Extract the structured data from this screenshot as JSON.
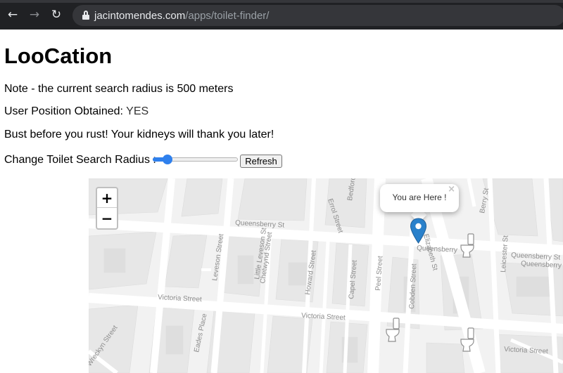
{
  "browser": {
    "url_host": "jacintomendes.com",
    "url_path": "/apps/toilet-finder/",
    "back_icon": "←",
    "forward_icon": "→",
    "reload_icon": "↻"
  },
  "page": {
    "title": "LooCation",
    "note": "Note - the current search radius is 500 meters",
    "position_label": "User Position Obtained: ",
    "position_value": "YES",
    "tagline": "Bust before you rust! Your kidneys will thank you later!",
    "radius_label": "Change Toilet Search Radius : ",
    "radius_slider_fraction": 0.17,
    "refresh_label": "Refresh"
  },
  "map": {
    "zoom_in": "+",
    "zoom_out": "−",
    "popup_text": "You are Here !",
    "popup_close": "×",
    "street_labels": [
      "Queensberry St",
      "Queensberry St",
      "Queensberry",
      "Queensberry",
      "Victoria Street",
      "Victoria Street",
      "Victoria Street",
      "Chetwynd Street",
      "Howard Street",
      "Capel Street",
      "Peel Street",
      "Cobden Street",
      "Leveson Street",
      "Little Leveson St",
      "Eades Place",
      "Elizabeth St",
      "Leicester St",
      "Berry St",
      "Bedford St",
      "Errol Street",
      "Wreckyn Street"
    ],
    "colors": {
      "background": "#f2f2f2",
      "road": "#ffffff",
      "block": "#e6e6e6",
      "pin": "#2a81cb",
      "label": "#8c8c8c"
    },
    "icons": [
      "location-pin-icon",
      "toilet-icon",
      "toilet-icon",
      "toilet-icon"
    ]
  }
}
